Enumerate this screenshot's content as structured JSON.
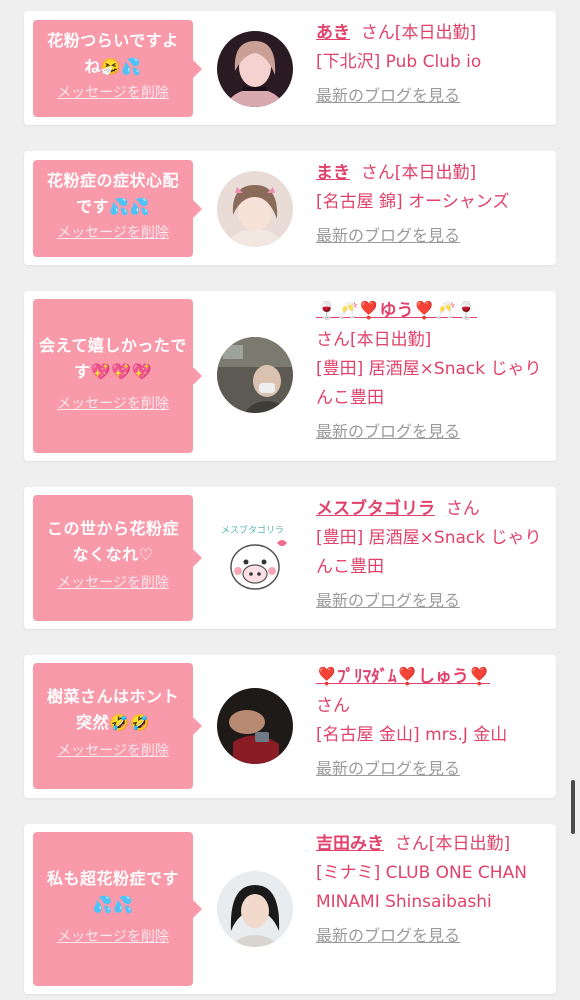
{
  "items": [
    {
      "message": "花粉つらいですよね",
      "message_emoji": "🤧💦",
      "delete_label": "メッセージを削除",
      "name": "あき",
      "suffix": "さん[本日出勤]",
      "shop": "[下北沢] Pub Club io",
      "blog_label": "最新のブログを見る",
      "avatar": "woman-portrait-icon"
    },
    {
      "message": "花粉症の症状心配です",
      "message_emoji": "💦💦",
      "delete_label": "メッセージを削除",
      "name": "まき",
      "suffix": "さん[本日出勤]",
      "shop": "[名古屋 錦] オーシャンズ",
      "blog_label": "最新のブログを見る",
      "avatar": "woman-portrait-icon"
    },
    {
      "message": "会えて嬉しかったです",
      "message_emoji": "💖💖💖",
      "delete_label": "メッセージを削除",
      "name": "🍷🥂❣️ゆう❣️🥂🍷",
      "suffix": "さん[本日出勤]",
      "shop": "[豊田] 居酒屋×Snack じゃりんこ豊田",
      "blog_label": "最新のブログを見る",
      "avatar": "selfie-photo-icon"
    },
    {
      "message": "この世から花粉症なくなれ♡",
      "message_emoji": "",
      "delete_label": "メッセージを削除",
      "name": "メスブタゴリラ",
      "suffix": "さん",
      "shop": "[豊田] 居酒屋×Snack じゃりんこ豊田",
      "blog_label": "最新のブログを見る",
      "avatar": "gorilla-cartoon-icon",
      "avatar_text": "メスブタゴリラ"
    },
    {
      "message": "樹菜さんはホント突然",
      "message_emoji": "🤣🤣",
      "delete_label": "メッセージを削除",
      "name": "❣️ﾌﾟﾘﾏﾀﾞﾑ❣️しゅう❣️",
      "suffix": "さん",
      "shop": "[名古屋 金山] mrs.J 金山",
      "blog_label": "最新のブログを見る",
      "avatar": "dark-photo-icon"
    },
    {
      "message": "私も超花粉症です",
      "message_emoji": "💦💦",
      "delete_label": "メッセージを削除",
      "name": "吉田みき",
      "suffix": "さん[本日出勤]",
      "shop": "[ミナミ] CLUB ONE CHAN MINAMI Shinsaibashi",
      "blog_label": "最新のブログを見る",
      "avatar": "woman-portrait-icon"
    }
  ],
  "colors": {
    "bubble": "#f99aab",
    "accent": "#e0426b",
    "link_gray": "#9a9a9a",
    "background": "#efefef"
  }
}
